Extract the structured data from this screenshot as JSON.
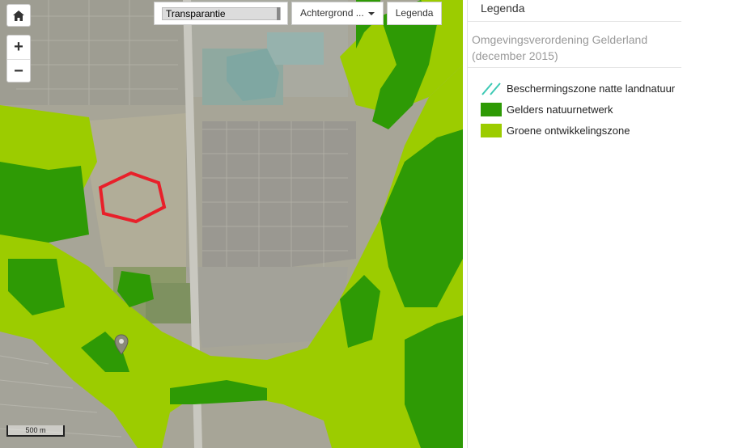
{
  "toolbar": {
    "transparency_label": "Transparantie",
    "background_label": "Achtergrond ...",
    "legend_button": "Legenda"
  },
  "map": {
    "scale_label": "500 m"
  },
  "legend_panel": {
    "title": "Legenda",
    "layer_name": "Omgevingsverordening Gelderland (december 2015)",
    "items": [
      {
        "label": "Beschermingszone natte landnatuur",
        "color": "#3cc9b4",
        "style": "hatched"
      },
      {
        "label": "Gelders natuurnetwerk",
        "color": "#2e9a05"
      },
      {
        "label": "Groene ontwikkelingszone",
        "color": "#9ccc00"
      }
    ]
  },
  "colors": {
    "natuurnetwerk": "#2e9a05",
    "ontwikkelingszone": "#9ccc00",
    "selection_outline": "#e8202a"
  }
}
